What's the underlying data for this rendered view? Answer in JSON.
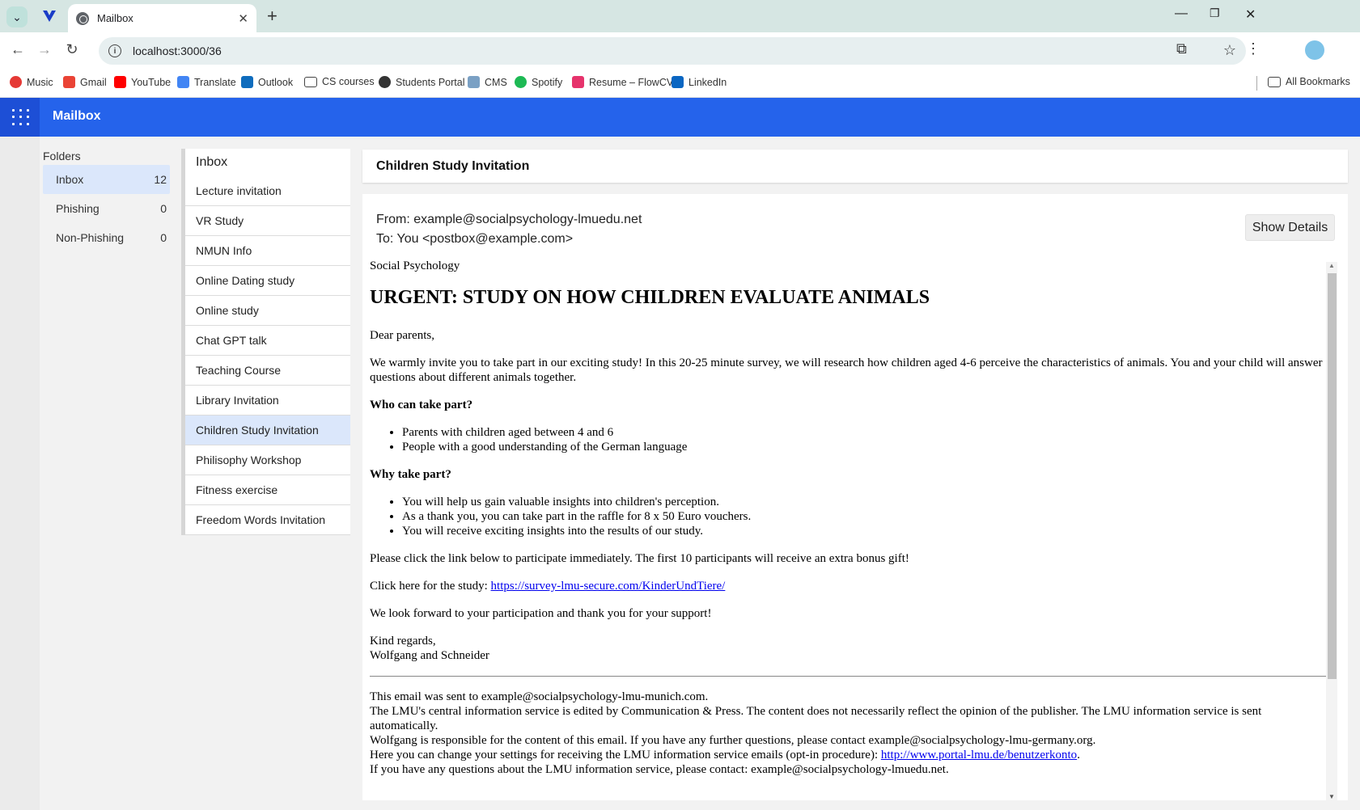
{
  "browser": {
    "tab_title": "Mailbox",
    "url": "localhost:3000/36",
    "new_tab_symbol": "+",
    "bookmarks": [
      {
        "label": "Music",
        "color": "#e53935"
      },
      {
        "label": "Gmail",
        "color": "#ea4335"
      },
      {
        "label": "YouTube",
        "color": "#ff0000"
      },
      {
        "label": "Translate",
        "color": "#4285f4"
      },
      {
        "label": "Outlook",
        "color": "#0f6cbd"
      },
      {
        "label": "CS courses",
        "color": "#444444"
      },
      {
        "label": "Students Portal",
        "color": "#333333"
      },
      {
        "label": "CMS",
        "color": "#7aa0c4"
      },
      {
        "label": "Spotify",
        "color": "#1db954"
      },
      {
        "label": "Resume – FlowCV",
        "color": "#e6336c"
      },
      {
        "label": "LinkedIn",
        "color": "#0a66c2"
      }
    ],
    "all_bookmarks": "All Bookmarks"
  },
  "app": {
    "title": "Mailbox"
  },
  "folders": {
    "heading": "Folders",
    "items": [
      {
        "label": "Inbox",
        "count": "12"
      },
      {
        "label": "Phishing",
        "count": "0"
      },
      {
        "label": "Non-Phishing",
        "count": "0"
      }
    ]
  },
  "inbox": {
    "heading": "Inbox",
    "items": [
      "Lecture invitation",
      "VR Study",
      "NMUN Info",
      "Online Dating study",
      "Online study",
      "Chat GPT talk",
      "Teaching Course",
      "Library Invitation",
      "Children Study Invitation",
      "Philisophy Workshop",
      "Fitness exercise",
      "Freedom Words Invitation"
    ],
    "selected_index": 8
  },
  "message": {
    "subject": "Children Study Invitation",
    "from": "From: example@socialpsychology-lmuedu.net",
    "to": "To: You <postbox@example.com>",
    "details_button": "Show Details",
    "body": {
      "org": "Social Psychology",
      "headline": "URGENT: STUDY ON HOW CHILDREN EVALUATE ANIMALS",
      "greeting": "Dear parents,",
      "intro": "We warmly invite you to take part in our exciting study! In this 20-25 minute survey, we will research how children aged 4-6 perceive the characteristics of animals. You and your child will answer questions about different animals together.",
      "who_heading": "Who can take part?",
      "who_items": [
        "Parents with children aged between 4 and 6",
        "People with a good understanding of the German language"
      ],
      "why_heading": "Why take part?",
      "why_items": [
        "You will help us gain valuable insights into children's perception.",
        "As a thank you, you can take part in the raffle for 8 x 50 Euro vouchers.",
        "You will receive exciting insights into the results of our study."
      ],
      "cta": "Please click the link below to participate immediately. The first 10 participants will receive an extra bonus gift!",
      "link_prefix": "Click here for the study: ",
      "link_text": "https://survey-lmu-secure.com/KinderUndTiere/",
      "thanks": "We look forward to your participation and thank you for your support!",
      "regards": "Kind regards,",
      "signature": "Wolfgang and Schneider",
      "footer": {
        "line1": "This email was sent to example@socialpsychology-lmu-munich.com.",
        "line2": "The LMU's central information service is edited by Communication & Press. The content does not necessarily reflect the opinion of the publisher. The LMU information service is sent automatically.",
        "line3": "Wolfgang is responsible for the content of this email. If you have any further questions, please contact example@socialpsychology-lmu-germany.org.",
        "line4_prefix": "Here you can change your settings for receiving the LMU information service emails (opt-in procedure): ",
        "line4_link": "http://www.portal-lmu.de/benutzerkonto",
        "line4_suffix": ".",
        "line5": "If you have any questions about the LMU information service, please contact: example@socialpsychology-lmuedu.net."
      }
    }
  },
  "colors": {
    "header_blue": "#2563eb",
    "selected_bg": "#dbe7fb",
    "link": "#0000ee"
  }
}
